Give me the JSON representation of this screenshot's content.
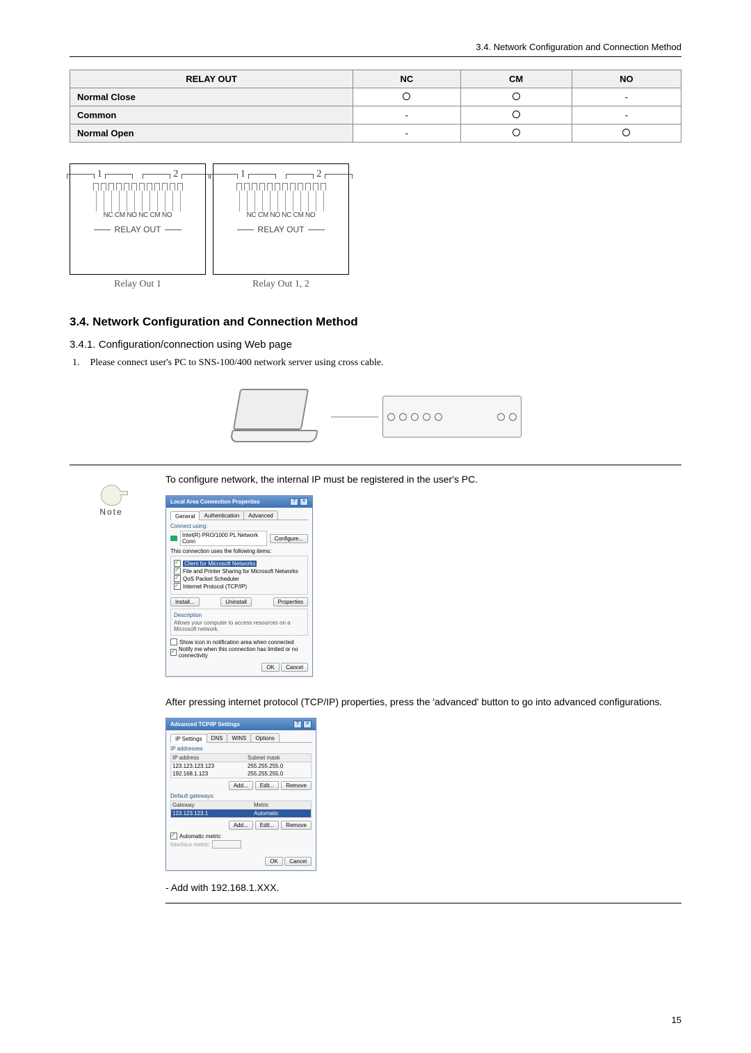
{
  "header": {
    "section_ref": "3.4. Network Configuration and Connection Method"
  },
  "relay_table": {
    "headers": [
      "RELAY OUT",
      "NC",
      "CM",
      "NO"
    ],
    "rows": [
      {
        "label": "Normal Close",
        "cells": [
          "circle",
          "circle",
          "dash"
        ]
      },
      {
        "label": "Common",
        "cells": [
          "dash",
          "circle",
          "dash"
        ]
      },
      {
        "label": "Normal Open",
        "cells": [
          "dash",
          "circle",
          "circle"
        ]
      }
    ]
  },
  "relay_diagram": {
    "t1": "1",
    "t2": "2",
    "pins_a": "NC CM NO NC CM NO",
    "pins_b": "NC CM NO NC CM NO",
    "label_a": "RELAY OUT",
    "label_b": "RELAY OUT",
    "caption_a": "Relay Out 1",
    "caption_b": "Relay Out 1, 2"
  },
  "sections": {
    "h2": "3.4. Network Configuration and Connection Method",
    "h3": "3.4.1. Configuration/connection using Web page",
    "step1_num": "1.",
    "step1_text": "Please connect user's PC to SNS-100/400 network server using cross cable."
  },
  "note": {
    "label": "Note",
    "line1": "To configure network, the internal IP must be registered in the user's PC.",
    "para2": "After pressing internet protocol (TCP/IP) properties, press the 'advanced' button to go into advanced configurations.",
    "add_line": "- Add with 192.168.1.XXX."
  },
  "dialog_lan": {
    "title": "Local Area Connection Properties",
    "tabs": [
      "General",
      "Authentication",
      "Advanced"
    ],
    "connect_using_label": "Connect using:",
    "adapter": "Intel(R) PRO/1000 PL Network Conn",
    "configure": "Configure...",
    "items_label": "This connection uses the following items:",
    "items": [
      {
        "checked": true,
        "highlight": true,
        "text": "Client for Microsoft Networks"
      },
      {
        "checked": true,
        "highlight": false,
        "text": "File and Printer Sharing for Microsoft Networks"
      },
      {
        "checked": true,
        "highlight": false,
        "text": "QoS Packet Scheduler"
      },
      {
        "checked": true,
        "highlight": false,
        "text": "Internet Protocol (TCP/IP)"
      }
    ],
    "install": "Install...",
    "uninstall": "Uninstall",
    "properties": "Properties",
    "desc_label": "Description",
    "desc_text": "Allows your computer to access resources on a Microsoft network.",
    "chk_notify": "Show icon in notification area when connected",
    "chk_limited": "Notify me when this connection has limited or no connectivity",
    "ok": "OK",
    "cancel": "Cancel"
  },
  "dialog_tcp": {
    "title": "Advanced TCP/IP Settings",
    "tabs": [
      "IP Settings",
      "DNS",
      "WINS",
      "Options"
    ],
    "ip_group": "IP addresses",
    "ip_cols": [
      "IP address",
      "Subnet mask"
    ],
    "ip_rows": [
      {
        "ip": "123.123.123.123",
        "mask": "255.255.255.0",
        "sel": false
      },
      {
        "ip": "192.168.1.123",
        "mask": "255.255.255.0",
        "sel": false
      }
    ],
    "gw_group": "Default gateways:",
    "gw_cols": [
      "Gateway",
      "Metric"
    ],
    "gw_rows": [
      {
        "gw": "123.123.123.1",
        "metric": "Automatic",
        "sel": true
      }
    ],
    "add": "Add...",
    "edit": "Edit...",
    "remove": "Remove",
    "auto_metric": "Automatic metric",
    "if_metric": "Interface metric:",
    "ok": "OK",
    "cancel": "Cancel"
  },
  "page_number": "15"
}
